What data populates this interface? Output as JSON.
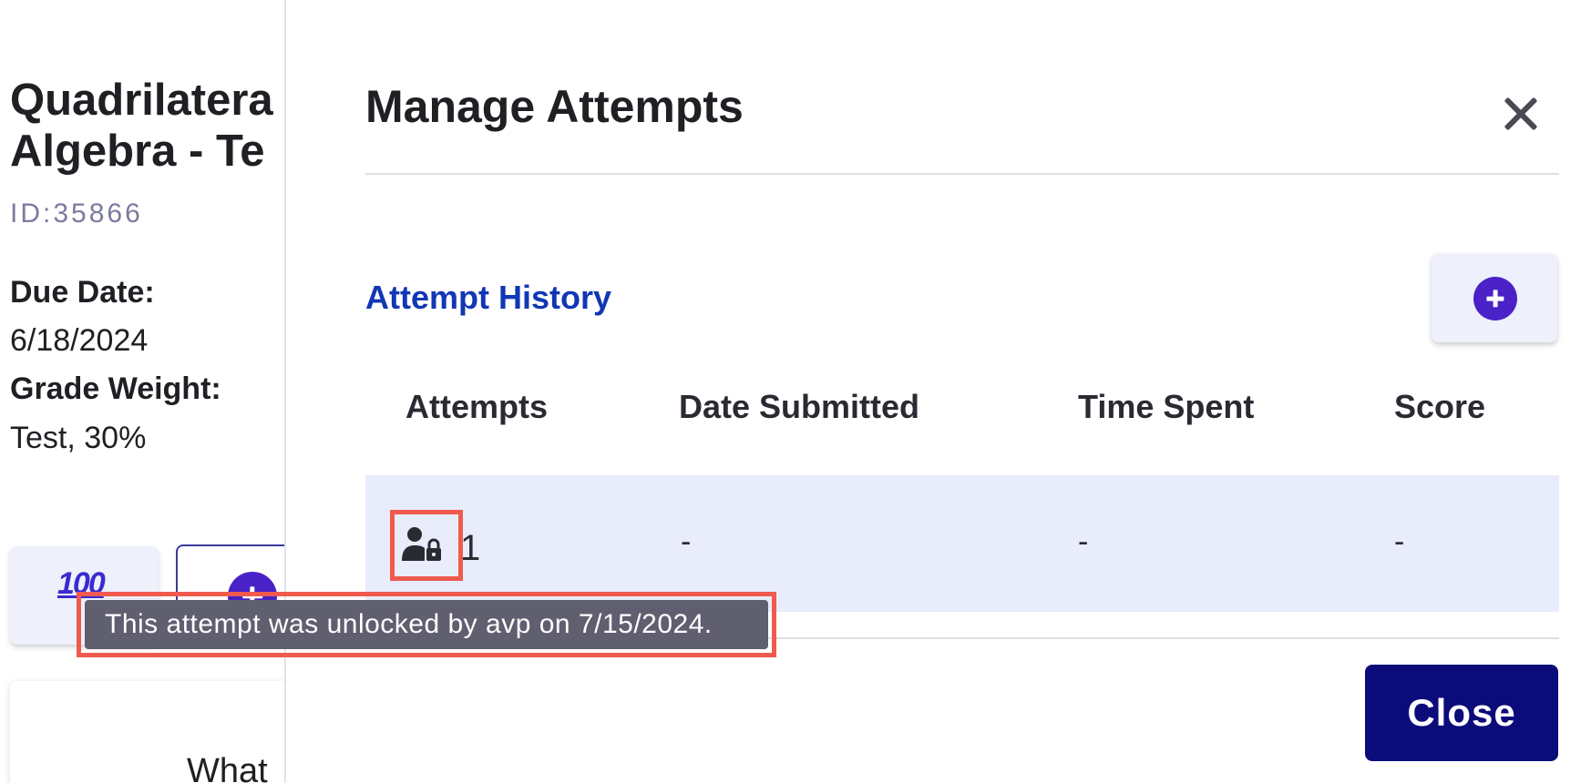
{
  "background": {
    "title_line1": "Quadrilatera",
    "title_line2": "Algebra - Te",
    "id_text": "ID:35866",
    "due_date_label": "Due Date:",
    "due_date_value": "6/18/2024",
    "grade_weight_label": "Grade Weight:",
    "grade_weight_value": "Test, 30%",
    "score_icon_text": "100",
    "card_text": "What"
  },
  "drawer": {
    "title": "Manage Attempts",
    "section_title": "Attempt History",
    "columns": [
      "Attempts",
      "Date Submitted",
      "Time Spent",
      "Score"
    ],
    "rows": [
      {
        "attempt": "1",
        "date_submitted": "-",
        "time_spent": "-",
        "score": "-",
        "status_icon": "user-lock-icon"
      }
    ],
    "close_button": "Close"
  },
  "tooltip": {
    "text": "This attempt was unlocked by avp on 7/15/2024."
  },
  "colors": {
    "accent_purple": "#4a22c7",
    "section_blue": "#1237b5",
    "close_button_navy": "#0b0b7a",
    "row_highlight": "#e8ecfb",
    "annotation_red": "#f05a4e",
    "tooltip_bg": "#5f5f70"
  }
}
